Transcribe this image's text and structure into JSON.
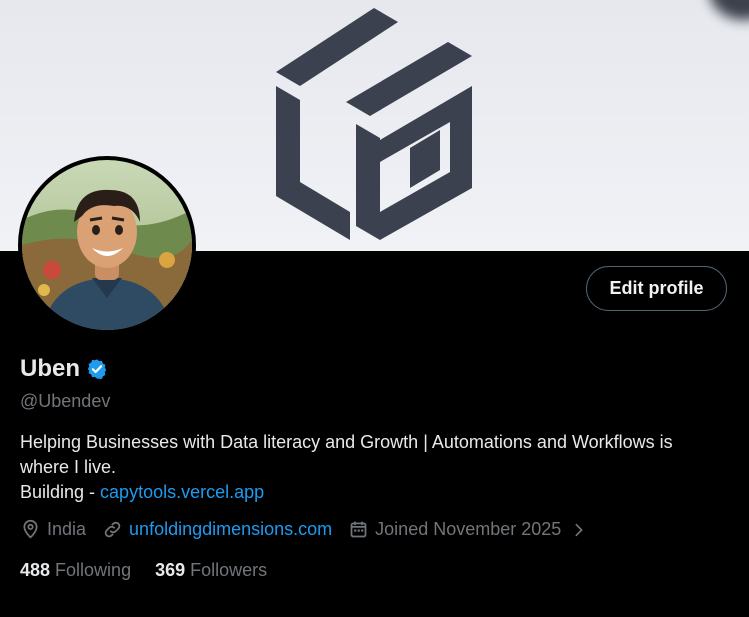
{
  "profile": {
    "name": "Uben",
    "handle": "@Ubendev",
    "edit_label": "Edit profile",
    "bio_line1": "Helping Businesses with Data literacy and Growth | Automations and Workflows is",
    "bio_line2": "where I live.",
    "bio_building_prefix": "Building - ",
    "bio_link": "capytools.vercel.app",
    "location": "India",
    "website": "unfoldingdimensions.com",
    "joined": "Joined November 2025",
    "following_count": "488",
    "following_label": "Following",
    "followers_count": "369",
    "followers_label": "Followers"
  },
  "icons": {
    "verified": "verified-badge-icon",
    "location": "location-pin-icon",
    "link": "link-icon",
    "calendar": "calendar-icon",
    "chevron": "chevron-right-icon"
  },
  "colors": {
    "background": "#000000",
    "text": "#e7e9ea",
    "muted": "#71767b",
    "link": "#1d9bf0",
    "logo": "#3b414e"
  }
}
